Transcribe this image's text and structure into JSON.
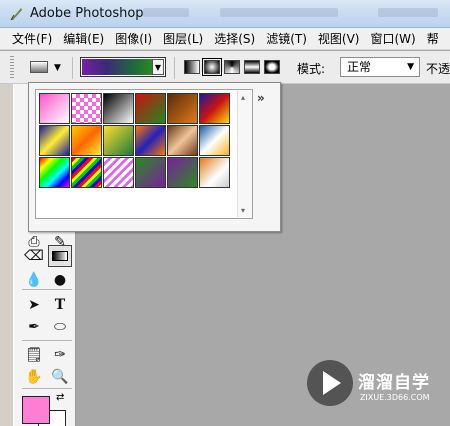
{
  "window": {
    "title": "Adobe Photoshop"
  },
  "menu": {
    "items": [
      "文件(F)",
      "编辑(E)",
      "图像(I)",
      "图层(L)",
      "选择(S)",
      "滤镜(T)",
      "视图(V)",
      "窗口(W)",
      "帮"
    ]
  },
  "options": {
    "gradient_types": [
      "linear",
      "radial",
      "angle",
      "reflected",
      "diamond"
    ],
    "active_gradient_type": "radial",
    "mode_label": "模式:",
    "mode_value": "正常",
    "opacity_label": "不透"
  },
  "gradient_picker": {
    "menu_button": "»",
    "swatches": [
      "linear-gradient(135deg,#ff55cc,#ffffff)",
      "repeating-conic-gradient(#ff66dd 0 25%,#ffffff 0 50%) 0 0/8px 8px",
      "linear-gradient(135deg,#000000,#ffffff)",
      "linear-gradient(135deg,#cc1111,#1f8a1f)",
      "linear-gradient(135deg,#5a2a0a,#e07a1a)",
      "linear-gradient(135deg,#1a1a9a,#cc1111,#ffdd00)",
      "linear-gradient(135deg,#1a1aa0,#ffee33,#1a1aa0)",
      "linear-gradient(135deg,#ffcc00,#ff6600,#ffee33)",
      "linear-gradient(135deg,#ffdd33,#1f7a3a)",
      "linear-gradient(135deg,#ff7700,#2222bb,#ff7700)",
      "linear-gradient(135deg,#6b3a1a,#f2c49a,#6b3a1a)",
      "linear-gradient(135deg,#1a5aa0,#ffffff,#f5b520)",
      "linear-gradient(135deg,#ff0000,#ffff00,#00ff00,#00ffff,#0000ff,#ff00ff)",
      "repeating-linear-gradient(135deg,#ff0000 0 3px,#ffff00 3px 6px,#00cc00 6px 9px,#0000ff 9px 12px)",
      "repeating-linear-gradient(135deg,#ffffff 0 3px,#dd66ee 3px 6px)",
      "linear-gradient(135deg,#2b8a20,#7a1fa2)",
      "linear-gradient(135deg,#7a1fa2,#2b8a20)",
      "linear-gradient(135deg,#e07a1a,#ffffff 60%,#cccccc)"
    ],
    "scroll_up": "▴",
    "scroll_down": "▾"
  },
  "toolbox": {
    "foreground_color": "#ff7fd4",
    "background_color": "#ffffff"
  },
  "watermark": {
    "title": "溜溜自学",
    "subtitle": "ZIXUE.3D66.COM"
  }
}
